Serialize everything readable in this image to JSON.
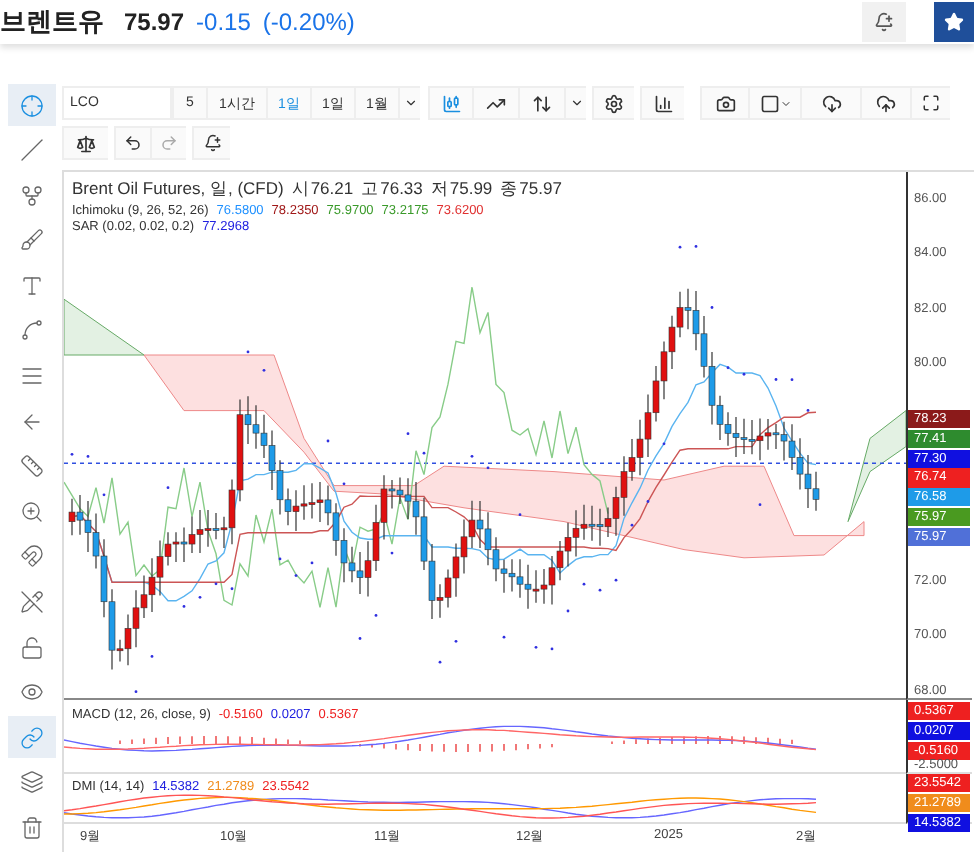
{
  "header": {
    "title": "브렌트유",
    "price": "75.97",
    "change": "-0.15",
    "change_pct": "(-0.20%)"
  },
  "sidebar": {
    "tools": [
      {
        "kind": "crosshair",
        "selected": true
      },
      {
        "kind": "line",
        "selected": false
      },
      {
        "kind": "fork",
        "selected": false
      },
      {
        "kind": "brush",
        "selected": false
      },
      {
        "kind": "text",
        "selected": false
      },
      {
        "kind": "pattern",
        "selected": false
      },
      {
        "kind": "fib",
        "selected": false
      },
      {
        "kind": "back",
        "selected": false
      },
      {
        "kind": "ruler",
        "selected": false
      },
      {
        "kind": "zoom",
        "selected": false
      },
      {
        "kind": "magnet",
        "selected": false
      },
      {
        "kind": "pencil-lock",
        "selected": false
      },
      {
        "kind": "lock",
        "selected": false
      },
      {
        "kind": "eye",
        "selected": false
      },
      {
        "kind": "link",
        "selected": true
      },
      {
        "kind": "layers",
        "selected": false
      },
      {
        "kind": "trash",
        "selected": false
      }
    ]
  },
  "toolbar": {
    "symbol": "LCO",
    "intervals": [
      {
        "label": "5",
        "selected": false
      },
      {
        "label": "1시간",
        "selected": false
      },
      {
        "label": "1일",
        "selected": true
      },
      {
        "label": "1일",
        "selected": false
      },
      {
        "label": "1월",
        "selected": false
      }
    ]
  },
  "chart": {
    "legend": {
      "title": "Brent Oil Futures, 일, (CFD)",
      "ohlc": [
        {
          "label": "시",
          "value": "76.21"
        },
        {
          "label": "고",
          "value": "76.33"
        },
        {
          "label": "저",
          "value": "75.99"
        },
        {
          "label": "종",
          "value": "75.97"
        }
      ]
    },
    "indicators": [
      {
        "name": "Ichimoku (9, 26, 52, 26)",
        "values": [
          {
            "text": "76.5800",
            "color": "#1e90ff"
          },
          {
            "text": "78.2350",
            "color": "#a01818"
          },
          {
            "text": "75.9700",
            "color": "#3a9a2a"
          },
          {
            "text": "73.2175",
            "color": "#3a9a2a"
          },
          {
            "text": "73.6200",
            "color": "#e03030"
          }
        ]
      },
      {
        "name": "SAR (0.02, 0.02, 0.2)",
        "values": [
          {
            "text": "77.2968",
            "color": "#2020e0"
          }
        ]
      }
    ],
    "price_axis": [
      "86.00",
      "84.00",
      "82.00",
      "80.00",
      "72.00",
      "70.00",
      "68.00"
    ],
    "price_tags": [
      {
        "text": "78.23",
        "color": "#8b1a1a"
      },
      {
        "text": "77.41",
        "color": "#2e8b2e"
      },
      {
        "text": "77.30",
        "color": "#1010e0"
      },
      {
        "text": "76.74",
        "color": "#ee2020"
      },
      {
        "text": "76.58",
        "color": "#1e9be8"
      },
      {
        "text": "75.97",
        "color": "#4a9a20"
      },
      {
        "text": "75.97",
        "color": "#5070d8"
      }
    ]
  },
  "macd": {
    "name": "MACD (12, 26, close, 9)",
    "values": [
      {
        "text": "-0.5160",
        "color": "#ee2020"
      },
      {
        "text": "0.0207",
        "color": "#2020e0"
      },
      {
        "text": "0.5367",
        "color": "#ee2020"
      }
    ],
    "tags": [
      {
        "text": "0.5367",
        "color": "#ee2020"
      },
      {
        "text": "0.0207",
        "color": "#1010e0"
      },
      {
        "text": "-0.5160",
        "color": "#ee2020"
      }
    ],
    "axis_label": "-2.5000"
  },
  "dmi": {
    "name": "DMI (14, 14)",
    "values": [
      {
        "text": "14.5382",
        "color": "#2020e0"
      },
      {
        "text": "21.2789",
        "color": "#f08c1c"
      },
      {
        "text": "23.5542",
        "color": "#ee2020"
      }
    ],
    "tags": [
      {
        "text": "23.5542",
        "color": "#ee2020"
      },
      {
        "text": "21.2789",
        "color": "#f08c1c"
      },
      {
        "text": "14.5382",
        "color": "#1010e0"
      }
    ]
  },
  "time_axis": [
    "9월",
    "10월",
    "11월",
    "12월",
    "2025",
    "2월"
  ]
}
